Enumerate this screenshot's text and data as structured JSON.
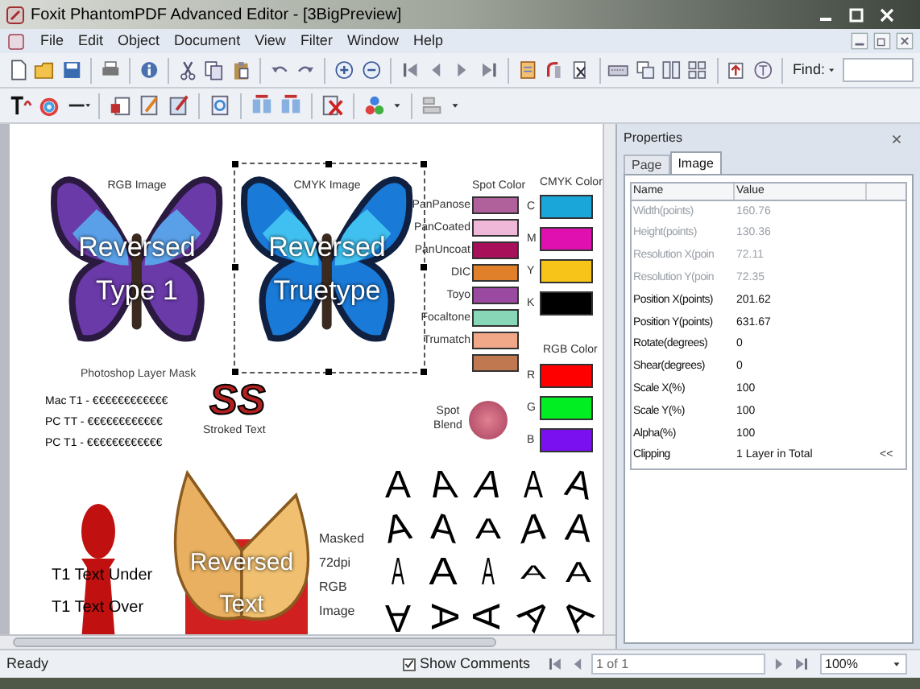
{
  "window": {
    "title": "Foxit PhantomPDF Advanced Editor - [3BigPreview]"
  },
  "menu": [
    "File",
    "Edit",
    "Object",
    "Document",
    "View",
    "Filter",
    "Window",
    "Help"
  ],
  "find": {
    "label": "Find:"
  },
  "document": {
    "butterflies": [
      {
        "kind": "rgb",
        "caption": "RGB Image",
        "overlay": [
          "Reversed",
          "Type 1"
        ],
        "selected": false
      },
      {
        "kind": "cmyk",
        "caption": "CMYK Image",
        "overlay": [
          "Reversed",
          "Truetype"
        ],
        "selected": true
      }
    ],
    "mask_caption": "Photoshop Layer Mask",
    "font_samples": [
      "Mac T1 - €€€€€€€€€€€€",
      "PC TT - €€€€€€€€€€€€",
      "PC T1 - €€€€€€€€€€€€"
    ],
    "stroked": {
      "glyphs": "SS",
      "caption": "Stroked Text"
    },
    "spot_colors": {
      "title": "Spot Color",
      "items": [
        {
          "label": "PanPanose",
          "color": "#b0609a"
        },
        {
          "label": "PanCoated",
          "color": "#f0b8d8"
        },
        {
          "label": "PanUncoat",
          "color": "#a8105a"
        },
        {
          "label": "DIC",
          "color": "#e0802a"
        },
        {
          "label": "Toyo",
          "color": "#9a4aa0"
        },
        {
          "label": "Focaltone",
          "color": "#88d8b8"
        },
        {
          "label": "Trumatch",
          "color": "#f0a888"
        },
        {
          "color": "#c07850"
        }
      ]
    },
    "cmyk_colors": {
      "title": "CMYK Color",
      "items": [
        {
          "label": "C",
          "color": "#1aa6d8"
        },
        {
          "label": "M",
          "color": "#e010b0"
        },
        {
          "label": "Y",
          "color": "#f7c51a"
        },
        {
          "label": "K",
          "color": "#000000"
        }
      ]
    },
    "rgb_colors": {
      "title": "RGB Color",
      "items": [
        {
          "label": "R",
          "color": "#ff0000"
        },
        {
          "label": "G",
          "color": "#00ee22"
        },
        {
          "label": "B",
          "color": "#7a10f0"
        }
      ]
    },
    "spot_blend": {
      "label": "Spot Blend"
    },
    "pawn_text": [
      "T1 Text Under",
      "T1 Text Over"
    ],
    "reversed_text": [
      "Reversed",
      "Text"
    ],
    "masked_caption": "Masked 72dpi RGB Image",
    "glyph_samples": [
      "A",
      "A",
      "A",
      "A",
      "A",
      "A",
      "A",
      "A",
      "A",
      "A",
      "A",
      "A",
      "A",
      "A",
      "A",
      "A",
      "A",
      "A",
      "A",
      "A"
    ]
  },
  "properties": {
    "title": "Properties",
    "tabs": [
      {
        "label": "Page",
        "selected": false
      },
      {
        "label": "Image",
        "selected": true
      }
    ],
    "columns": [
      "Name",
      "Value"
    ],
    "rows": [
      {
        "name": "Width(points)",
        "value": "160.76",
        "disabled": true
      },
      {
        "name": "Height(points)",
        "value": "130.36",
        "disabled": true
      },
      {
        "name": "Resolution X(poin",
        "value": "72.11",
        "disabled": true
      },
      {
        "name": "Resolution Y(poin",
        "value": "72.35",
        "disabled": true
      },
      {
        "name": "Position X(points)",
        "value": "201.62",
        "disabled": false
      },
      {
        "name": "Position Y(points)",
        "value": "631.67",
        "disabled": false
      },
      {
        "name": "Rotate(degrees)",
        "value": "0",
        "disabled": false
      },
      {
        "name": "Shear(degrees)",
        "value": "0",
        "disabled": false
      },
      {
        "name": "Scale X(%)",
        "value": "100",
        "disabled": false
      },
      {
        "name": "Scale Y(%)",
        "value": "100",
        "disabled": false
      },
      {
        "name": "Alpha(%)",
        "value": "100",
        "disabled": false
      },
      {
        "name": "Clipping",
        "value": "1 Layer in Total",
        "disabled": false,
        "action": "<<"
      }
    ]
  },
  "status_bar": {
    "text": "Ready",
    "show_comments": {
      "label": "Show Comments",
      "checked": true
    },
    "page": "1 of 1",
    "zoom": "100%"
  }
}
